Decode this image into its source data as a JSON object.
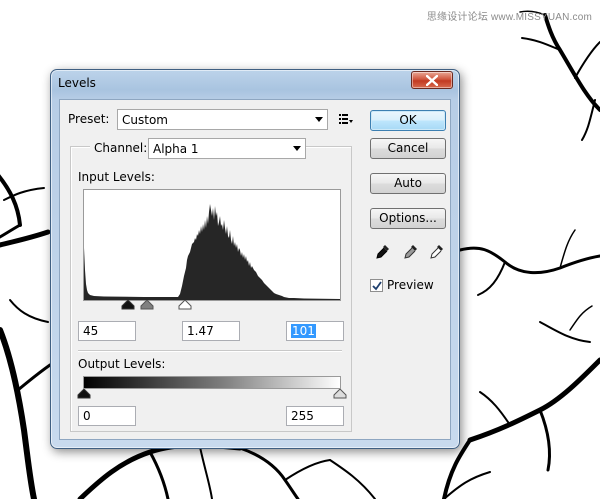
{
  "watermark": "思缘设计论坛 www.MISSYUAN.com",
  "dialog": {
    "title": "Levels",
    "preset": {
      "label": "Preset:",
      "value": "Custom"
    },
    "channel": {
      "label": "Channel:",
      "value": "Alpha 1"
    },
    "input_levels": {
      "label": "Input Levels:",
      "black": "45",
      "gamma": "1.47",
      "white_prefix": "",
      "white": "101"
    },
    "output_levels": {
      "label": "Output Levels:",
      "black": "0",
      "white": "255"
    },
    "buttons": {
      "ok": "OK",
      "cancel": "Cancel",
      "auto": "Auto",
      "options": "Options..."
    },
    "preview": {
      "label": "Preview",
      "checked": true
    },
    "eyedroppers": [
      "black-point-eyedropper-icon",
      "gray-point-eyedropper-icon",
      "white-point-eyedropper-icon"
    ],
    "colors": {
      "title_bar": "#a9c4e0",
      "close_button": "#c23a22",
      "default_button": "#a7d9f5",
      "selection": "#3399ff"
    }
  }
}
